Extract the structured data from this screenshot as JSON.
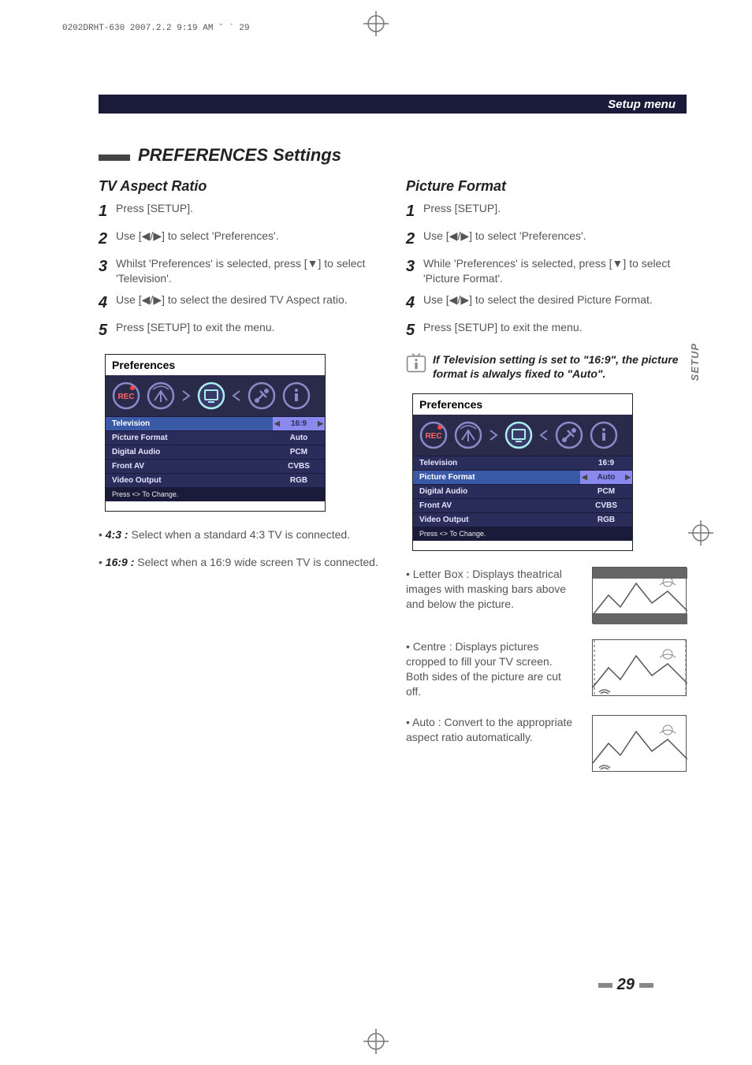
{
  "print_header": "0202DRHT-630  2007.2.2 9:19 AM  ˘   `   29",
  "breadcrumb_bar": "Setup menu",
  "side_tab": "SETUP",
  "section_title": "PREFERENCES Settings",
  "tv_aspect": {
    "heading": "TV Aspect Ratio",
    "steps": [
      "Press [SETUP].",
      "Use [◀/▶] to select 'Preferences'.",
      "Whilst 'Preferences' is selected, press [▼] to select 'Television'.",
      "Use [◀/▶] to select the desired TV Aspect ratio.",
      "Press [SETUP] to exit the menu."
    ],
    "opt_defs": [
      {
        "term": "4:3 :",
        "desc": "Select when a standard 4:3 TV is connected."
      },
      {
        "term": "16:9 :",
        "desc": "Select when a 16:9 wide screen TV is connected."
      }
    ]
  },
  "picture_format": {
    "heading": "Picture Format",
    "steps": [
      "Press [SETUP].",
      "Use [◀/▶] to select 'Preferences'.",
      "While 'Preferences' is selected, press [▼] to select 'Picture Format'.",
      "Use [◀/▶] to select the desired  Picture Format.",
      "Press [SETUP] to exit the menu."
    ],
    "note": "If Television setting is set to \"16:9\", the picture format is alwalys fixed to \"Auto\".",
    "opt_defs": [
      {
        "term": "Letter Box :",
        "desc": "Displays theatrical images with masking bars above and below the picture."
      },
      {
        "term": "Centre :",
        "desc": "Displays pictures cropped to fill your TV screen. Both sides of the picture are cut off."
      },
      {
        "term": "Auto :",
        "desc": "Convert to the appropriate aspect ratio automatically."
      }
    ]
  },
  "osd": {
    "panel_title": "Preferences",
    "rows": [
      {
        "label": "Television",
        "value": "16:9"
      },
      {
        "label": "Picture Format",
        "value": "Auto"
      },
      {
        "label": "Digital Audio",
        "value": "PCM"
      },
      {
        "label": "Front AV",
        "value": "CVBS"
      },
      {
        "label": "Video Output",
        "value": "RGB"
      }
    ],
    "help": "Press <> To Change.",
    "left_selected_index": 0,
    "right_selected_index": 1,
    "icon_names": [
      "rec-icon",
      "antenna-icon",
      "tv-prefs-icon",
      "tools-icon",
      "info-icon"
    ]
  },
  "page_number": "29"
}
